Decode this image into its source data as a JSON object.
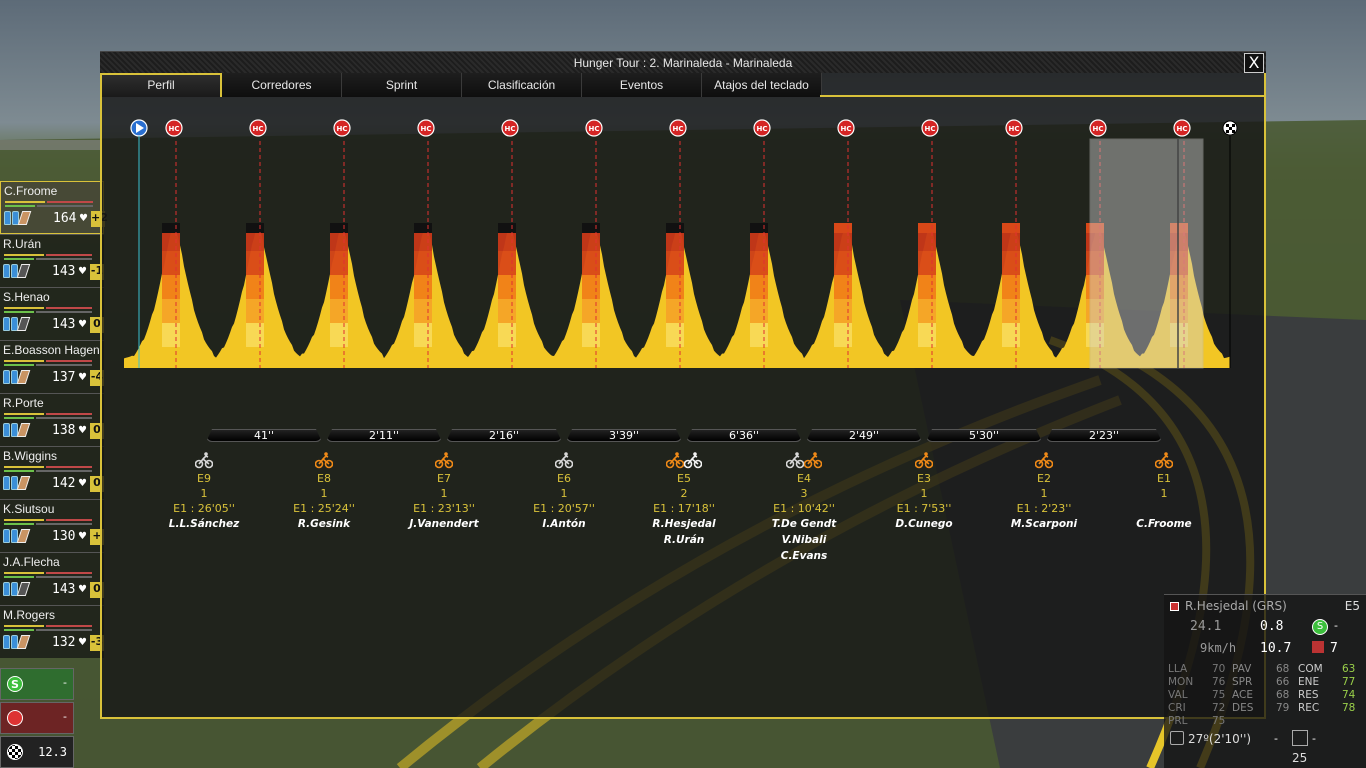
{
  "window": {
    "title": "Hunger Tour : 2. Marinaleda - Marinaleda",
    "close_label": "X"
  },
  "tabs": [
    {
      "label": "Perfil",
      "active": true
    },
    {
      "label": "Corredores",
      "active": false
    },
    {
      "label": "Sprint",
      "active": false
    },
    {
      "label": "Clasificación",
      "active": false
    },
    {
      "label": "Eventos",
      "active": false
    },
    {
      "label": "Atajos del teclado",
      "active": false
    }
  ],
  "profile": {
    "climb_badge": "HC",
    "climb_count": 13,
    "start_icon": "play-icon",
    "finish_icon": "checkered-flag-icon"
  },
  "gaps": [
    "41''",
    "2'11''",
    "2'16''",
    "3'39''",
    "6'36''",
    "2'49''",
    "5'30''",
    "2'23''"
  ],
  "groups": [
    {
      "label": "E9",
      "count": "1",
      "time": "E1 : 26'05''",
      "names": [
        "L.L.Sánchez"
      ],
      "bikes": [
        "grey"
      ]
    },
    {
      "label": "E8",
      "count": "1",
      "time": "E1 : 25'24''",
      "names": [
        "R.Gesink"
      ],
      "bikes": [
        "orange"
      ]
    },
    {
      "label": "E7",
      "count": "1",
      "time": "E1 : 23'13''",
      "names": [
        "J.Vanendert"
      ],
      "bikes": [
        "orange"
      ]
    },
    {
      "label": "E6",
      "count": "1",
      "time": "E1 : 20'57''",
      "names": [
        "I.Antón"
      ],
      "bikes": [
        "grey"
      ]
    },
    {
      "label": "E5",
      "count": "2",
      "time": "E1 : 17'18''",
      "names": [
        "R.Hesjedal",
        "R.Urán"
      ],
      "bikes": [
        "orange",
        "white"
      ]
    },
    {
      "label": "E4",
      "count": "3",
      "time": "E1 : 10'42''",
      "names": [
        "T.De Gendt",
        "V.Nibali",
        "C.Evans"
      ],
      "bikes": [
        "grey",
        "orange"
      ]
    },
    {
      "label": "E3",
      "count": "1",
      "time": "E1 : 7'53''",
      "names": [
        "D.Cunego"
      ],
      "bikes": [
        "orange"
      ]
    },
    {
      "label": "E2",
      "count": "1",
      "time": "E1 : 2'23''",
      "names": [
        "M.Scarponi"
      ],
      "bikes": [
        "orange"
      ]
    },
    {
      "label": "E1",
      "count": "1",
      "time": "",
      "names": [
        "C.Froome"
      ],
      "bikes": [
        "orange"
      ]
    }
  ],
  "riders": [
    {
      "name": "C.Froome",
      "hr": "164",
      "diff": "+2",
      "active": true,
      "food": "light",
      "side": "E1 65"
    },
    {
      "name": "R.Urán",
      "hr": "143",
      "diff": "-1",
      "active": false,
      "food": "dark",
      "side": "E5 85"
    },
    {
      "name": "S.Henao",
      "hr": "143",
      "diff": "0",
      "active": false,
      "food": "dark",
      "side": "E19 80"
    },
    {
      "name": "E.Boasson Hagen",
      "hr": "137",
      "diff": "-4",
      "active": false,
      "food": "light",
      "side": "E12 55"
    },
    {
      "name": "R.Porte",
      "hr": "138",
      "diff": "0",
      "active": false,
      "food": "light",
      "side": "CP 70"
    },
    {
      "name": "B.Wiggins",
      "hr": "142",
      "diff": "0",
      "active": false,
      "food": "light",
      "side": "A3 80"
    },
    {
      "name": "K.Siutsou",
      "hr": "130",
      "diff": "+",
      "active": false,
      "food": "light",
      "side": "A14 60"
    },
    {
      "name": "J.A.Flecha",
      "hr": "143",
      "diff": "0",
      "active": false,
      "food": "dark",
      "side": "A21 80"
    },
    {
      "name": "M.Rogers",
      "hr": "132",
      "diff": "-3",
      "active": false,
      "food": "light",
      "side": "A23 70"
    }
  ],
  "rider_info": {
    "name": "R.Hesjedal (GRS)",
    "group": "E5",
    "speed": "24.1",
    "slope": "0.8",
    "kmh": "9km/h",
    "dist": "10.7",
    "pos": "7",
    "stats_left": [
      {
        "k": "LLA",
        "v": "70"
      },
      {
        "k": "MON",
        "v": "76"
      },
      {
        "k": "VAL",
        "v": "75"
      },
      {
        "k": "CRI",
        "v": "72"
      },
      {
        "k": "PRL",
        "v": "75"
      }
    ],
    "stats_mid": [
      {
        "k": "PAV",
        "v": "68"
      },
      {
        "k": "SPR",
        "v": "66"
      },
      {
        "k": "ACE",
        "v": "68"
      },
      {
        "k": "DES",
        "v": "79"
      }
    ],
    "stats_right": [
      {
        "k": "COM",
        "v": "63"
      },
      {
        "k": "ENE",
        "v": "77"
      },
      {
        "k": "RES",
        "v": "74"
      },
      {
        "k": "REC",
        "v": "78"
      }
    ],
    "time": "27º(2'10'')",
    "bottom_right": "25"
  },
  "mini": {
    "value": "12.3"
  },
  "overlay": {
    "bg_name": "Urán",
    "bg_name2": "Hesj"
  }
}
